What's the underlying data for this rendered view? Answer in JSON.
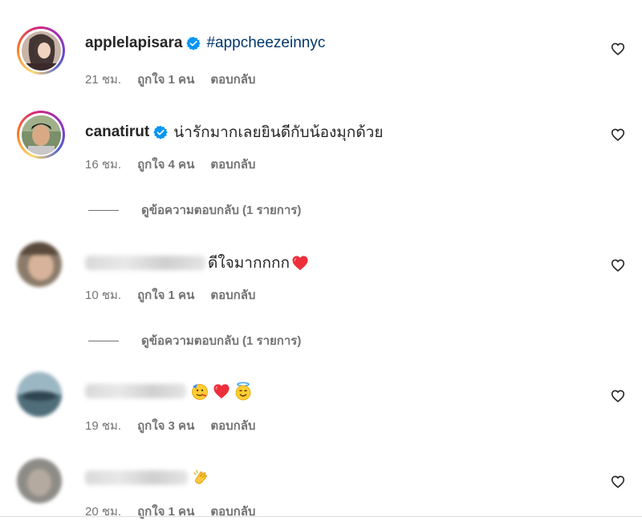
{
  "comments": [
    {
      "username": "applelapisara",
      "verified": true,
      "text": "#appcheezeinnyc",
      "time": "21 ชม.",
      "likes": "ถูกใจ 1 คน",
      "reply": "ตอบกลับ"
    },
    {
      "username": "canatirut",
      "verified": true,
      "text": "น่ารักมากเลยยินดีกับน้องมุกด้วย",
      "time": "16 ชม.",
      "likes": "ถูกใจ 4 คน",
      "reply": "ตอบกลับ",
      "view_replies": "ดูข้อความตอบกลับ (1 รายการ)"
    },
    {
      "username": "",
      "text": "ดีใจมากกกก",
      "emojis": [
        "red-heart"
      ],
      "time": "10 ชม.",
      "likes": "ถูกใจ 1 คน",
      "reply": "ตอบกลับ",
      "view_replies": "ดูข้อความตอบกลับ (1 รายการ)"
    },
    {
      "username": "",
      "text": "",
      "emojis": [
        "partying-face",
        "red-heart",
        "smiling-face-with-halo"
      ],
      "time": "19 ชม.",
      "likes": "ถูกใจ 3 คน",
      "reply": "ตอบกลับ"
    },
    {
      "username": "",
      "text": "",
      "emojis": [
        "clapping-hands"
      ],
      "time": "20 ชม.",
      "likes": "ถูกใจ 1 คน",
      "reply": "ตอบกลับ"
    }
  ],
  "icons": {
    "like": "heart-outline-icon",
    "verified": "verified-badge-icon"
  },
  "colors": {
    "verified": "#0095f6",
    "hashtag": "#00376b",
    "meta": "#737373",
    "heart": "#ed2f3b"
  }
}
